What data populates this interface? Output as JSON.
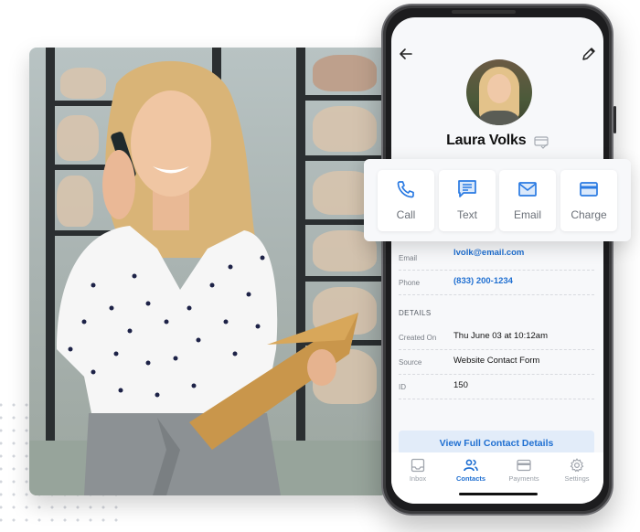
{
  "colors": {
    "accent": "#1f6fd1",
    "icon_blue": "#2a7ae2",
    "muted_text": "#7a7f87",
    "button_bg": "#e2ecf9"
  },
  "contact": {
    "name": "Laura Volks",
    "name_badge_icon": "card-check-icon"
  },
  "header": {
    "back_icon": "arrow-left-icon",
    "edit_icon": "pencil-icon"
  },
  "actions": [
    {
      "label": "Call",
      "icon": "phone-icon"
    },
    {
      "label": "Text",
      "icon": "message-icon"
    },
    {
      "label": "Email",
      "icon": "envelope-icon"
    },
    {
      "label": "Charge",
      "icon": "credit-card-icon"
    }
  ],
  "contact_info": [
    {
      "label": "Email",
      "value": "lvolk@email.com"
    },
    {
      "label": "Phone",
      "value": "(833) 200-1234"
    }
  ],
  "details": {
    "heading": "DETAILS",
    "rows": [
      {
        "label": "Created On",
        "value": "Thu June 03 at 10:12am"
      },
      {
        "label": "Source",
        "value": "Website Contact Form"
      },
      {
        "label": "ID",
        "value": "150"
      }
    ]
  },
  "view_full_button": "View Full Contact Details",
  "tabbar": {
    "active": "Contacts",
    "tabs": [
      {
        "label": "Inbox",
        "icon": "inbox-icon"
      },
      {
        "label": "Contacts",
        "icon": "people-icon"
      },
      {
        "label": "Payments",
        "icon": "credit-card-icon"
      },
      {
        "label": "Settings",
        "icon": "gear-icon"
      }
    ]
  }
}
